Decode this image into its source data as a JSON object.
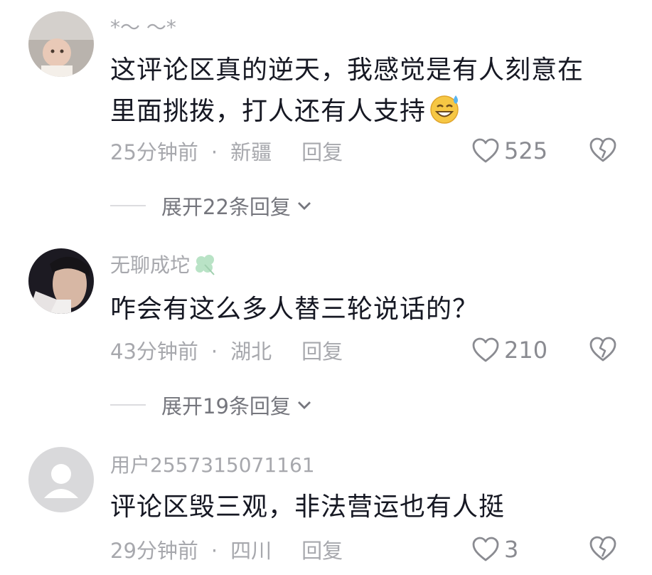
{
  "comments": [
    {
      "username": "*～ ～*",
      "text": "这评论区真的逆天，我感觉是有人刻意在里面挑拨，打人还有人支持",
      "time": "25分钟前",
      "location": "新疆",
      "reply_label": "回复",
      "likes": "525",
      "expand_label": "展开22条回复"
    },
    {
      "username": "无聊成坨",
      "text": "咋会有这么多人替三轮说话的？",
      "time": "43分钟前",
      "location": "湖北",
      "reply_label": "回复",
      "likes": "210",
      "expand_label": "展开19条回复"
    },
    {
      "username": "用户2557315071161",
      "text": "评论区毁三观，非法营运也有人挺",
      "time": "29分钟前",
      "location": "四川",
      "reply_label": "回复",
      "likes": "3"
    }
  ],
  "separator_dot": "·",
  "colors": {
    "text": "#161823",
    "meta": "#a7a8ad",
    "icon": "#8a8b91"
  }
}
